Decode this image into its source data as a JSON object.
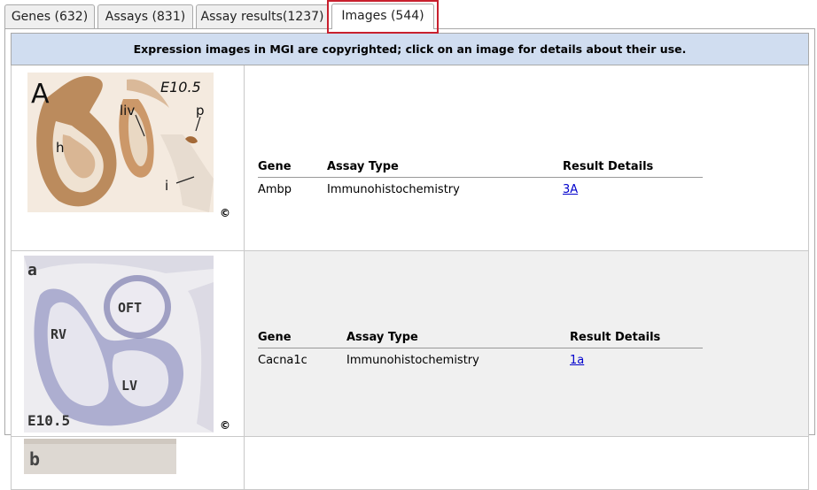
{
  "tabs": [
    {
      "label": "Genes (632)",
      "active": false
    },
    {
      "label": "Assays (831)",
      "active": false
    },
    {
      "label": "Assay results(1237)",
      "active": false
    },
    {
      "label": "Images (544)",
      "active": true
    }
  ],
  "notice": "Expression images in MGI are copyrighted; click on an image for details about their use.",
  "columns": {
    "gene": "Gene",
    "assay_type": "Assay Type",
    "result_details": "Result Details"
  },
  "copyright_symbol": "©",
  "results": [
    {
      "image_labels": [
        "A",
        "E10.5",
        "liv",
        "p",
        "h",
        "i"
      ],
      "gene": "Ambp",
      "assay_type": "Immunohistochemistry",
      "result_link": "3A"
    },
    {
      "image_labels": [
        "a",
        "OFT",
        "RV",
        "LV",
        "E10.5"
      ],
      "gene": "Cacna1c",
      "assay_type": "Immunohistochemistry",
      "result_link": "1a"
    },
    {
      "image_labels": [
        "b"
      ]
    }
  ],
  "colors": {
    "notice_bg": "#d0ddf0",
    "row_alt_bg": "#f0f0f0",
    "highlight": "#c8202e",
    "link": "#0000cc"
  }
}
